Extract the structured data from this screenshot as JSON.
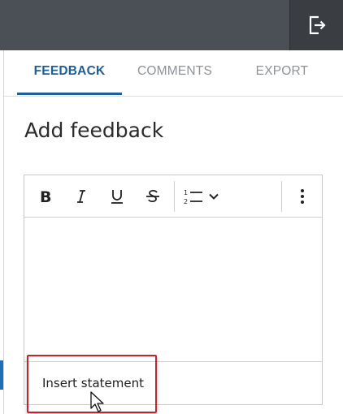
{
  "header": {
    "exit_icon": "exit-icon"
  },
  "tabs": [
    {
      "label": "FEEDBACK",
      "active": true
    },
    {
      "label": "COMMENTS",
      "active": false
    },
    {
      "label": "EXPORT",
      "active": false
    }
  ],
  "panel": {
    "title": "Add feedback"
  },
  "toolbar": {
    "bold_icon": "bold-icon",
    "italic_icon": "italic-icon",
    "underline_icon": "underline-icon",
    "strikethrough_icon": "strikethrough-icon",
    "ordered_list_icon": "ordered-list-icon",
    "chevron_icon": "chevron-down-icon",
    "more_icon": "more-vertical-icon"
  },
  "editor": {
    "value": ""
  },
  "footer": {
    "insert_label": "Insert statement"
  },
  "colors": {
    "accent": "#1d5f99",
    "topbar": "#4b4f56",
    "highlight": "#c0272d"
  }
}
